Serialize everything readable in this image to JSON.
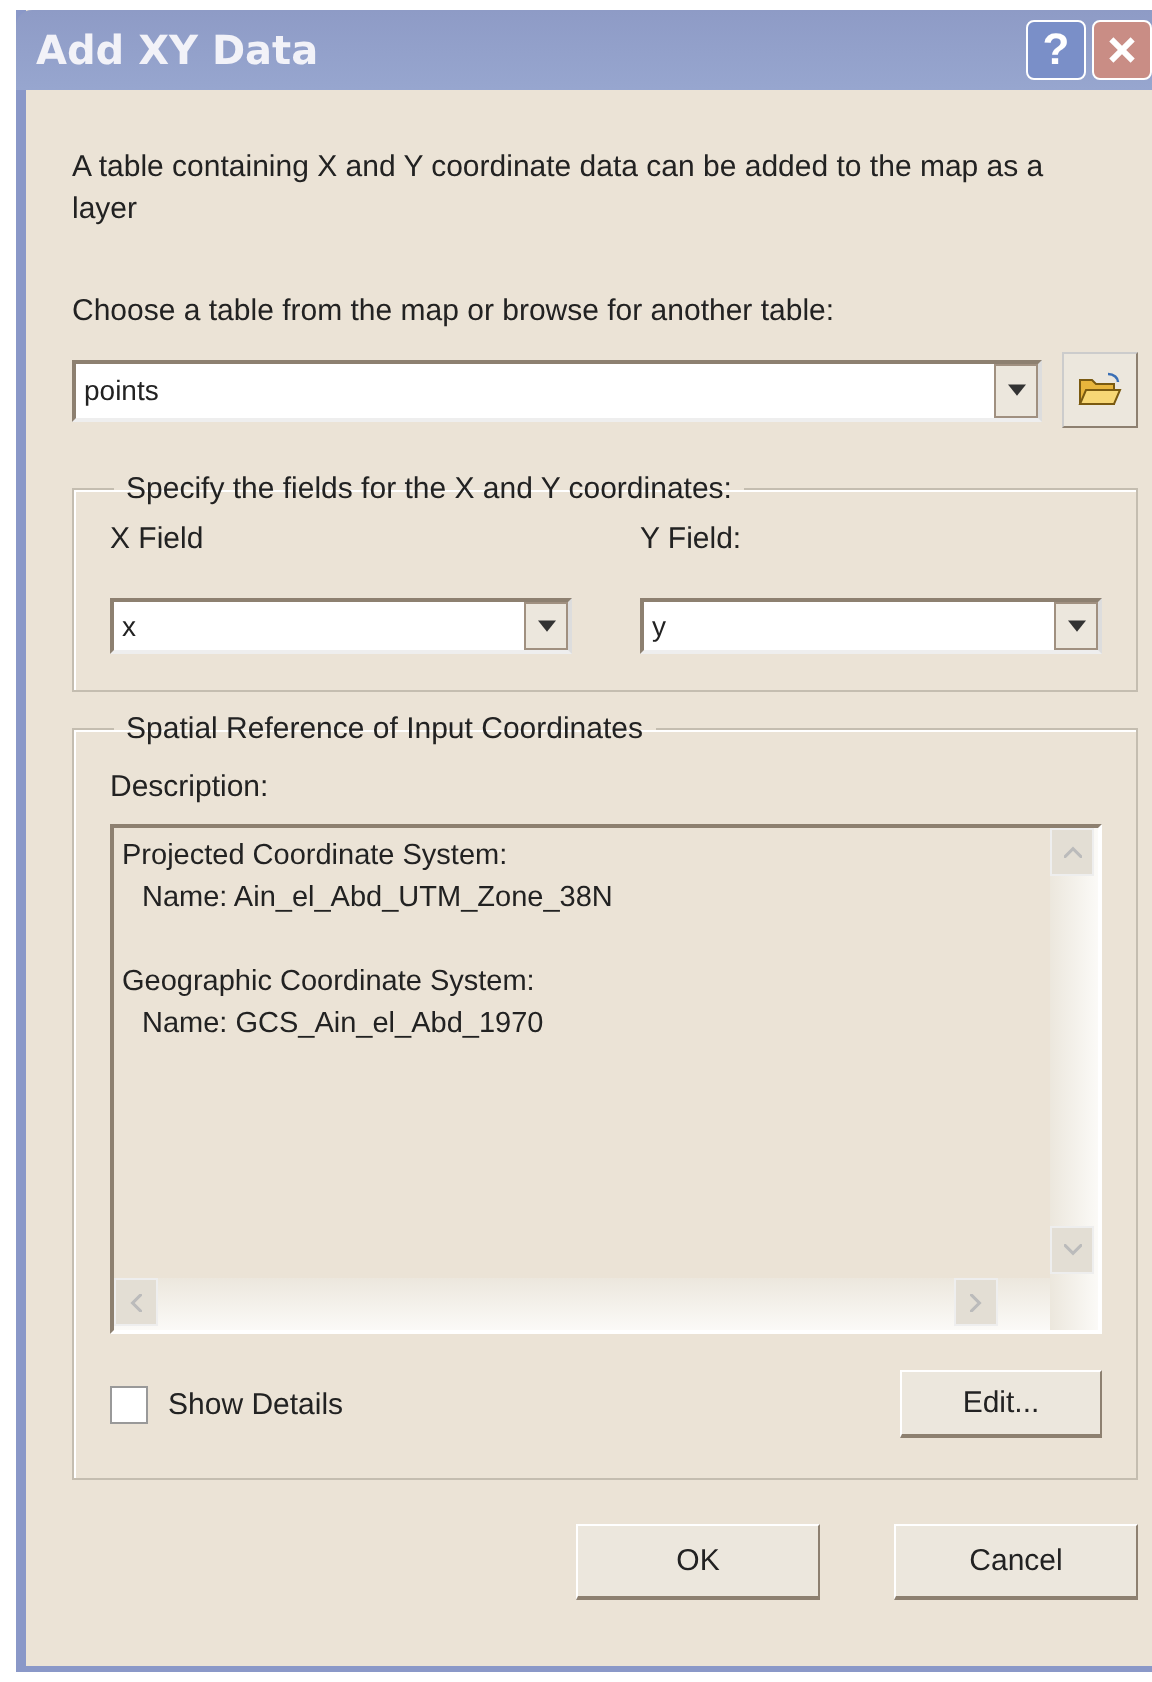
{
  "window": {
    "title": "Add XY Data",
    "help_button": "?"
  },
  "intro": "A table containing X and Y coordinate data can be added to the map as a layer",
  "table_prompt": "Choose a table from the map or browse for another table:",
  "table_combo": {
    "value": "points"
  },
  "fields_group": {
    "title": "Specify the fields for the X and Y coordinates:",
    "x_label": "X Field",
    "x_value": "x",
    "y_label": "Y Field:",
    "y_value": "y"
  },
  "spatial_group": {
    "title": "Spatial Reference of Input Coordinates",
    "description_label": "Description:",
    "description": [
      {
        "heading": "Projected Coordinate System:",
        "name": "Name: Ain_el_Abd_UTM_Zone_38N"
      },
      {
        "heading": "Geographic Coordinate System:",
        "name": "Name: GCS_Ain_el_Abd_1970"
      }
    ],
    "show_details": {
      "label": "Show Details",
      "checked": false
    },
    "edit_button": "Edit..."
  },
  "buttons": [
    "OK",
    "Cancel"
  ]
}
